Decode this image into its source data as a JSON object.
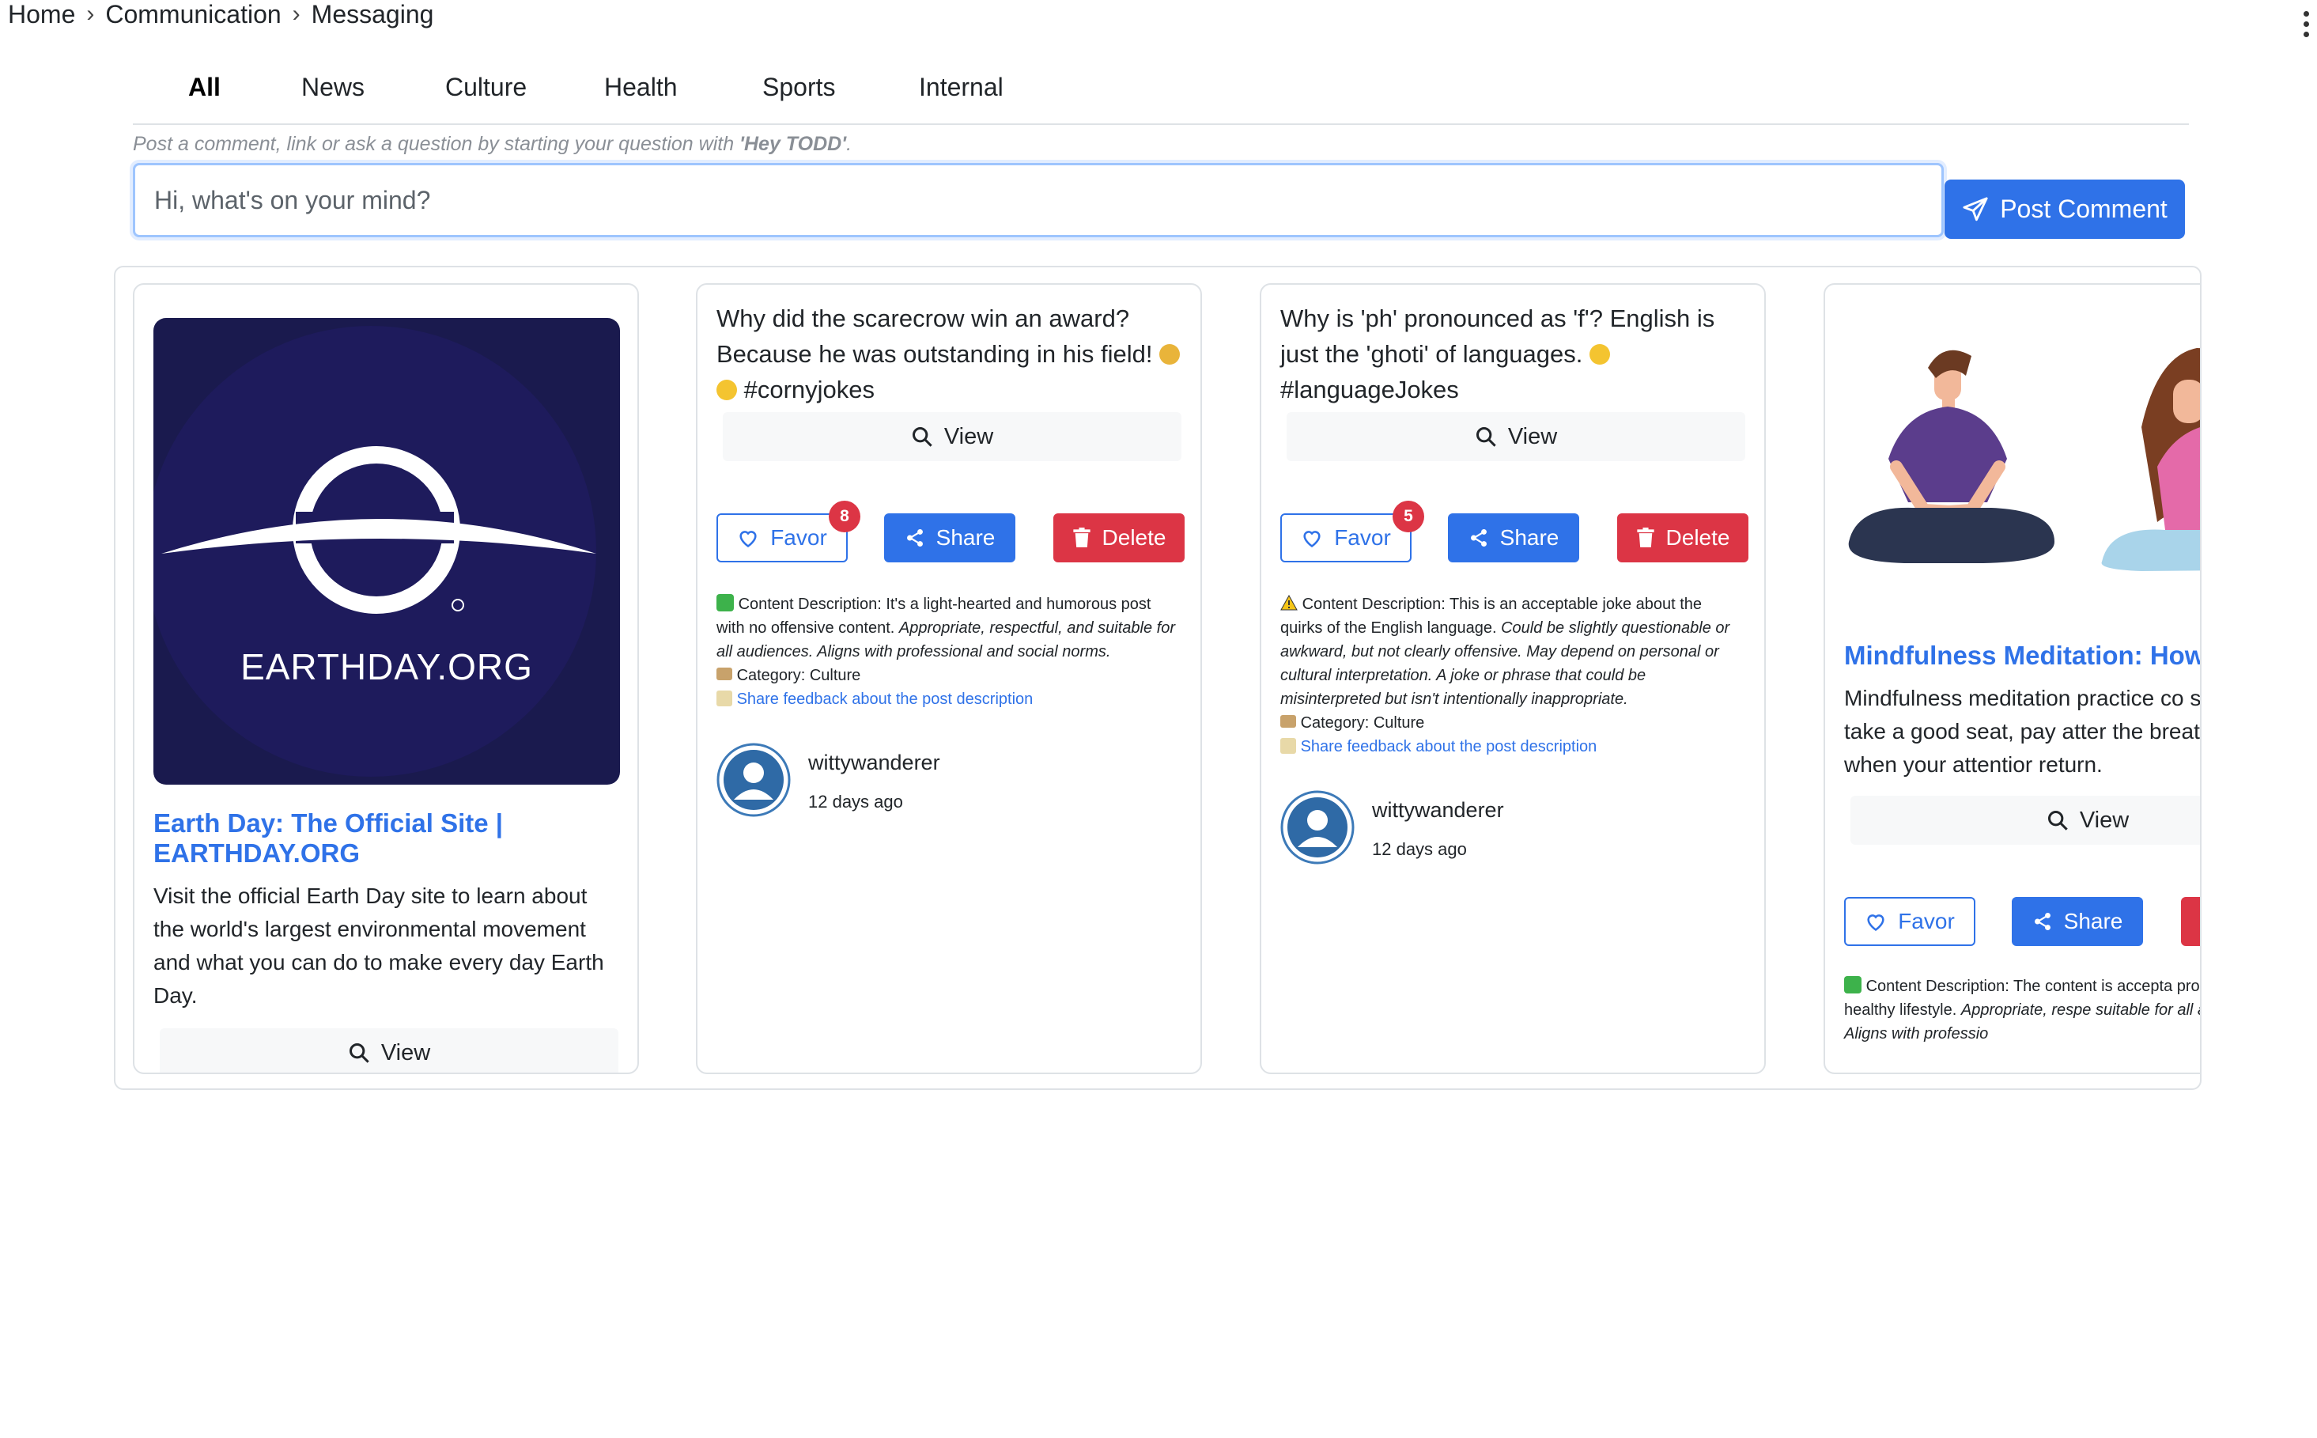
{
  "breadcrumb": {
    "items": [
      "Home",
      "Communication",
      "Messaging"
    ],
    "separator": "›"
  },
  "tabs": [
    "All",
    "News",
    "Culture",
    "Health",
    "Sports",
    "Internal"
  ],
  "composer": {
    "hint_prefix": "Post a comment, link or ask a question by starting your question with ",
    "hint_keyword": "'Hey TODD'",
    "hint_suffix": ".",
    "placeholder": "Hi, what's on your mind?",
    "post_label": "Post Comment"
  },
  "cards": [
    {
      "logo_text": "EARTHDAY.ORG",
      "title": "Earth Day: The Official Site | EARTHDAY.ORG",
      "body": "Visit the official Earth Day site to learn about the world's largest environmental movement and what you can do to make every day Earth Day.",
      "view_label": "View"
    },
    {
      "text": "Why did the scarecrow win an award? Because he was outstanding in his field!",
      "hashtag": "#cornyjokes",
      "view_label": "View",
      "favor_label": "Favor",
      "favor_count": "8",
      "share_label": "Share",
      "delete_label": "Delete",
      "desc_label": "Content Description: It's a light-hearted and humorous post with no offensive content.",
      "desc_italic": "Appropriate, respectful, and suitable for all audiences. Aligns with professional and social norms.",
      "category": "Category: Culture",
      "feedback": "Share feedback about the post description",
      "author": "wittywanderer",
      "time": "12 days ago"
    },
    {
      "text": "Why is 'ph' pronounced as 'f'? English is just the 'ghoti' of languages.",
      "hashtag": "#languageJokes",
      "view_label": "View",
      "favor_label": "Favor",
      "favor_count": "5",
      "share_label": "Share",
      "delete_label": "Delete",
      "desc_label": "Content Description: This is an acceptable joke about the quirks of the English language.",
      "desc_italic": "Could be slightly questionable or awkward, but not clearly offensive. May depend on personal or cultural interpretation. A joke or phrase that could be misinterpreted but isn't intentionally inappropriate.",
      "category": "Category: Culture",
      "feedback": "Share feedback about the post description",
      "author": "wittywanderer",
      "time": "12 days ago"
    },
    {
      "title": "Mindfulness Meditation: How",
      "body": "Mindfulness meditation practice co simpler: take a good seat, pay atter the breath, and when your attentior return.",
      "view_label": "View",
      "favor_label": "Favor",
      "share_label": "Share",
      "desc_label": "Content Description: The content is accepta promotes a healthy lifestyle.",
      "desc_italic": "Appropriate, respe suitable for all audiences. Aligns with professio"
    }
  ],
  "colors": {
    "primary": "#2f72e8",
    "danger": "#dc3545",
    "earth_bg": "#1a1a4e"
  }
}
